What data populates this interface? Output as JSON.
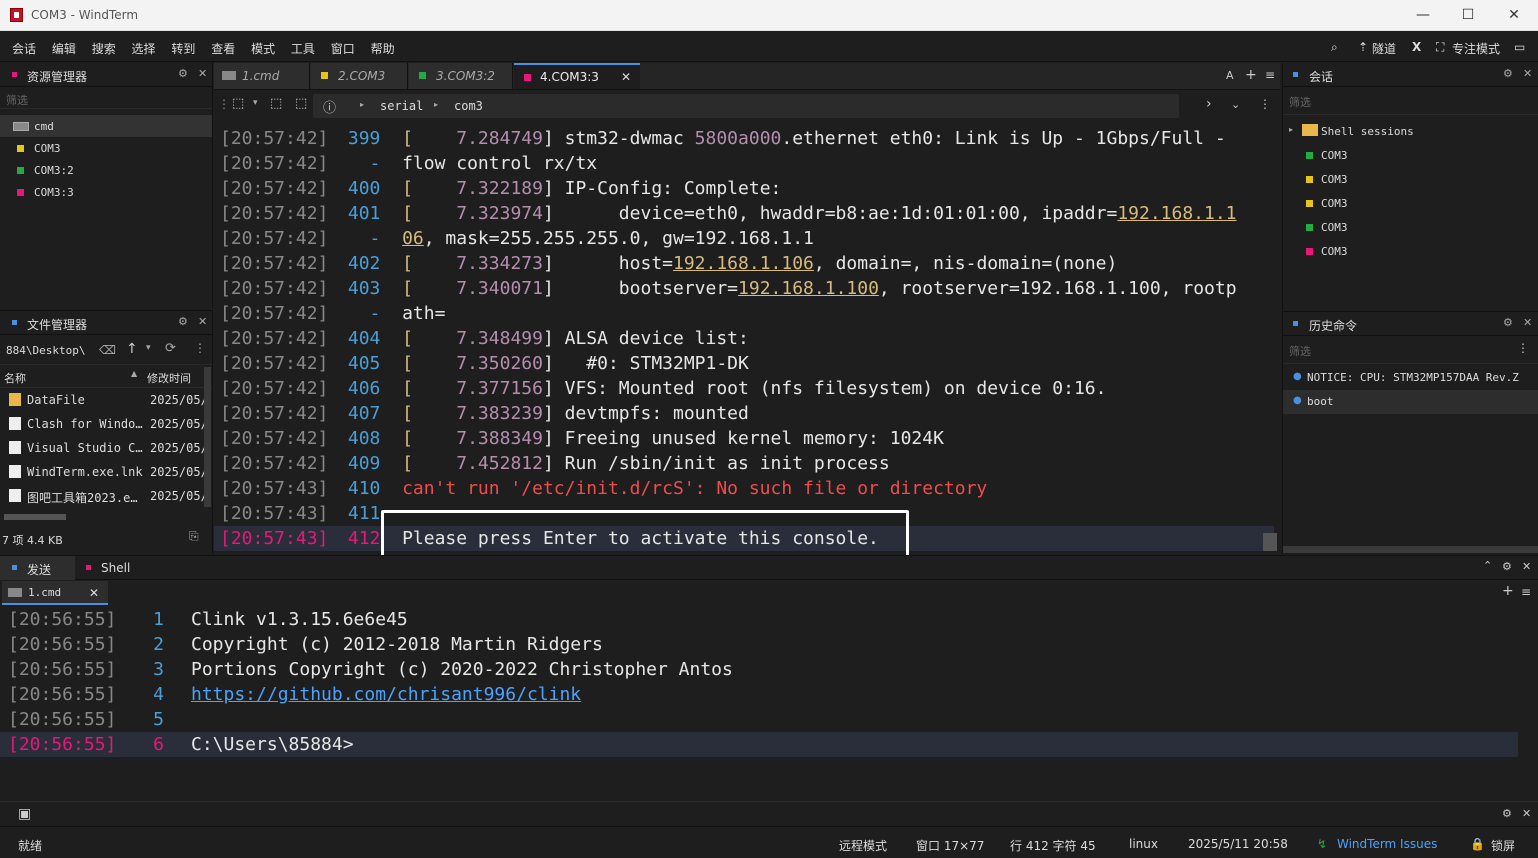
{
  "window": {
    "title": "COM3 - WindTerm"
  },
  "menu": {
    "items": [
      "会话",
      "编辑",
      "搜索",
      "选择",
      "转到",
      "查看",
      "模式",
      "工具",
      "窗口",
      "帮助"
    ],
    "tunnel": "隧道",
    "focus_mode": "专注模式"
  },
  "explorer": {
    "title": "资源管理器",
    "filter": "筛选",
    "items": [
      {
        "label": "cmd",
        "color": "#888888"
      },
      {
        "label": "COM3",
        "color": "#e8c31b"
      },
      {
        "label": "COM3:2",
        "color": "#22aa44"
      },
      {
        "label": "COM3:3",
        "color": "#e6197a"
      }
    ]
  },
  "files": {
    "title": "文件管理器",
    "path": "884\\Desktop\\",
    "col_name": "名称",
    "col_date": "修改时间",
    "rows": [
      {
        "name": "DataFile",
        "date": "2025/05/",
        "folder": true
      },
      {
        "name": "Clash for Windo…",
        "date": "2025/05/",
        "folder": false
      },
      {
        "name": "Visual Studio C…",
        "date": "2025/05/",
        "folder": false
      },
      {
        "name": "WindTerm.exe.lnk",
        "date": "2025/05/",
        "folder": false
      },
      {
        "name": "图吧工具箱2023.e…",
        "date": "2025/05/",
        "folder": false
      }
    ],
    "footer": "7 项 4.4 KB"
  },
  "tabs": [
    {
      "label": "1.cmd",
      "color": "#888888",
      "active": false
    },
    {
      "label": "2.COM3",
      "color": "#e8c31b",
      "active": false
    },
    {
      "label": "3.COM3:2",
      "color": "#22aa44",
      "active": false
    },
    {
      "label": "4.COM3:3",
      "color": "#e6197a",
      "active": true
    }
  ],
  "toolbar": {
    "crumb1": "serial",
    "crumb2": "com3"
  },
  "terminal": {
    "lines": [
      {
        "ts": "[20:57:42]",
        "ln": "399",
        "a": "[",
        "b": "    7.284749",
        "c": "] stm32-dwmac ",
        "d": "5800a000",
        "e": ".ethernet eth0: Link is Up - 1Gbps/Full - "
      },
      {
        "ts": "[20:57:42]",
        "ln": "-",
        "a": "",
        "b": "",
        "c": "flow control rx/tx",
        "d": "",
        "e": ""
      },
      {
        "ts": "[20:57:42]",
        "ln": "400",
        "a": "[",
        "b": "    7.322189",
        "c": "] IP-Config: Complete:",
        "d": "",
        "e": ""
      },
      {
        "ts": "[20:57:42]",
        "ln": "401",
        "a": "[",
        "b": "    7.323974",
        "c": "]      device=eth0, hwaddr=b8:ae:1d:01:01:00, ipaddr=",
        "d": "192.168.1.1",
        "e": ""
      },
      {
        "ts": "[20:57:42]",
        "ln": "-",
        "a": "",
        "b": "",
        "c": "",
        "d": "06",
        "e": ", mask=255.255.255.0, gw=192.168.1.1"
      },
      {
        "ts": "[20:57:42]",
        "ln": "402",
        "a": "[",
        "b": "    7.334273",
        "c": "]      host=",
        "d": "192.168.1.106",
        "e": ", domain=, nis-domain=(none)"
      },
      {
        "ts": "[20:57:42]",
        "ln": "403",
        "a": "[",
        "b": "    7.340071",
        "c": "]      bootserver=",
        "d": "192.168.1.100",
        "e": ", rootserver=192.168.1.100, rootp"
      },
      {
        "ts": "[20:57:42]",
        "ln": "-",
        "a": "",
        "b": "",
        "c": "ath=",
        "d": "",
        "e": ""
      },
      {
        "ts": "[20:57:42]",
        "ln": "404",
        "a": "[",
        "b": "    7.348499",
        "c": "] ALSA device list:",
        "d": "",
        "e": ""
      },
      {
        "ts": "[20:57:42]",
        "ln": "405",
        "a": "[",
        "b": "    7.350260",
        "c": "]   #0: STM32MP1-DK",
        "d": "",
        "e": ""
      },
      {
        "ts": "[20:57:42]",
        "ln": "406",
        "a": "[",
        "b": "    7.377156",
        "c": "] VFS: Mounted root (nfs filesystem) on device 0:16.",
        "d": "",
        "e": ""
      },
      {
        "ts": "[20:57:42]",
        "ln": "407",
        "a": "[",
        "b": "    7.383239",
        "c": "] devtmpfs: mounted",
        "d": "",
        "e": ""
      },
      {
        "ts": "[20:57:42]",
        "ln": "408",
        "a": "[",
        "b": "    7.388349",
        "c": "] Freeing unused kernel memory: 1024K",
        "d": "",
        "e": ""
      },
      {
        "ts": "[20:57:42]",
        "ln": "409",
        "a": "[",
        "b": "    7.452812",
        "c": "] Run /sbin/init as init process",
        "d": "",
        "e": ""
      },
      {
        "ts": "[20:57:43]",
        "ln": "410",
        "a": "",
        "b": "",
        "c": "can't run '/etc/init.d/rcS': No such file or directory",
        "d": "",
        "e": ""
      },
      {
        "ts": "[20:57:43]",
        "ln": "411",
        "a": "",
        "b": "",
        "c": "",
        "d": "",
        "e": ""
      },
      {
        "ts": "[20:57:43]",
        "ln": "412",
        "a": "",
        "b": "",
        "c": "Please press Enter to activate this console.",
        "d": "",
        "e": ""
      }
    ]
  },
  "sessions": {
    "title": "会话",
    "filter": "筛选",
    "group": "Shell sessions",
    "items": [
      {
        "label": "COM3",
        "color": "#22aa44"
      },
      {
        "label": "COM3",
        "color": "#e8c31b"
      },
      {
        "label": "COM3",
        "color": "#e8c31b"
      },
      {
        "label": "COM3",
        "color": "#22aa44"
      },
      {
        "label": "COM3",
        "color": "#e6197a"
      }
    ]
  },
  "history": {
    "title": "历史命令",
    "filter": "筛选",
    "items": [
      "NOTICE: CPU: STM32MP157DAA Rev.Z",
      "boot"
    ]
  },
  "bottom": {
    "tab_send": "发送",
    "tab_shell": "Shell",
    "subtab": "1.cmd",
    "lines": [
      {
        "ts": "[20:56:55]",
        "ln": "1",
        "text": "Clink v1.3.15.6e6e45"
      },
      {
        "ts": "[20:56:55]",
        "ln": "2",
        "text": "Copyright (c) 2012-2018 Martin Ridgers"
      },
      {
        "ts": "[20:56:55]",
        "ln": "3",
        "text": "Portions Copyright (c) 2020-2022 Christopher Antos"
      },
      {
        "ts": "[20:56:55]",
        "ln": "4",
        "text": "https://github.com/chrisant996/clink"
      },
      {
        "ts": "[20:56:55]",
        "ln": "5",
        "text": ""
      },
      {
        "ts": "[20:56:55]",
        "ln": "6",
        "text": "C:\\Users\\85884>"
      }
    ]
  },
  "status": {
    "ready": "就绪",
    "remote": "远程模式",
    "window": "窗口 17×77",
    "pos": "行 412 字符 45",
    "os": "linux",
    "datetime": "2025/5/11 20:58",
    "issues": "WindTerm Issues",
    "lock": "锁屏"
  }
}
